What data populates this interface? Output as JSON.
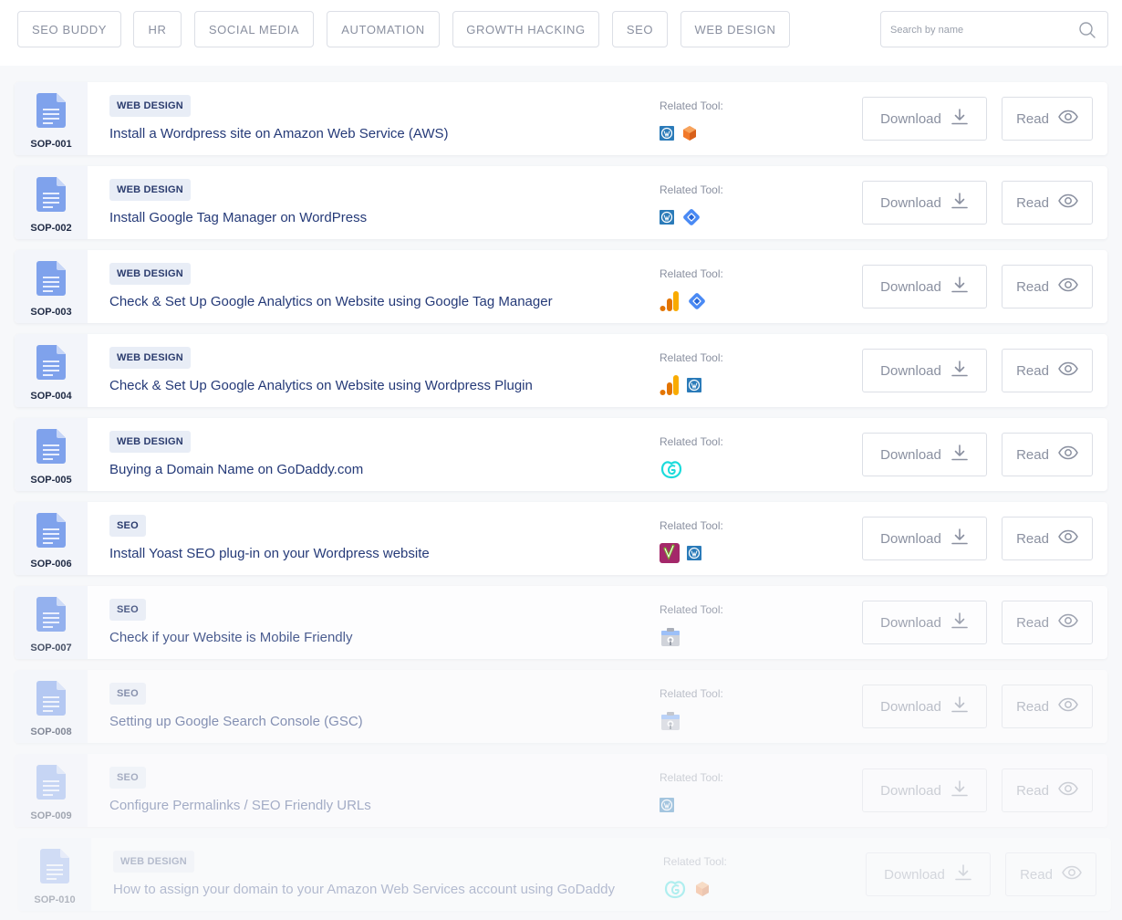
{
  "filters": [
    {
      "label": "SEO BUDDY"
    },
    {
      "label": "HR"
    },
    {
      "label": "SOCIAL MEDIA"
    },
    {
      "label": "AUTOMATION"
    },
    {
      "label": "GROWTH HACKING"
    },
    {
      "label": "SEO"
    },
    {
      "label": "WEB DESIGN"
    }
  ],
  "search": {
    "placeholder": "Search by name",
    "value": ""
  },
  "related_label": "Related Tool:",
  "download_label": "Download",
  "read_label": "Read",
  "sops": [
    {
      "code": "SOP-001",
      "category": "WEB DESIGN",
      "title": "Install a Wordpress site on Amazon Web Service (AWS)",
      "tools": [
        "wordpress-icon",
        "aws-icon"
      ]
    },
    {
      "code": "SOP-002",
      "category": "WEB DESIGN",
      "title": "Install Google Tag Manager on WordPress",
      "tools": [
        "wordpress-icon",
        "google-tag-manager-icon"
      ]
    },
    {
      "code": "SOP-003",
      "category": "WEB DESIGN",
      "title": "Check & Set Up Google Analytics on Website using Google Tag Manager",
      "tools": [
        "google-analytics-icon",
        "google-tag-manager-icon"
      ]
    },
    {
      "code": "SOP-004",
      "category": "WEB DESIGN",
      "title": "Check & Set Up Google Analytics on Website using Wordpress Plugin",
      "tools": [
        "google-analytics-icon",
        "wordpress-icon"
      ]
    },
    {
      "code": "SOP-005",
      "category": "WEB DESIGN",
      "title": "Buying a Domain Name on GoDaddy.com",
      "tools": [
        "godaddy-icon"
      ]
    },
    {
      "code": "SOP-006",
      "category": "SEO",
      "title": "Install Yoast SEO plug-in on your Wordpress website",
      "tools": [
        "yoast-icon",
        "wordpress-icon"
      ]
    },
    {
      "code": "SOP-007",
      "category": "SEO",
      "title": "Check if your Website is Mobile Friendly",
      "tools": [
        "search-console-icon"
      ]
    },
    {
      "code": "SOP-008",
      "category": "SEO",
      "title": "Setting up Google Search Console (GSC)",
      "tools": [
        "search-console-icon"
      ]
    },
    {
      "code": "SOP-009",
      "category": "SEO",
      "title": "Configure Permalinks / SEO Friendly URLs",
      "tools": [
        "wordpress-icon"
      ]
    },
    {
      "code": "SOP-010",
      "category": "WEB DESIGN",
      "title": "How to assign your domain to your Amazon Web Services account using GoDaddy",
      "tools": [
        "godaddy-icon",
        "aws-icon"
      ]
    }
  ],
  "colors": {
    "accent_text": "#253a78",
    "badge_bg": "#e8edf6",
    "doc_icon": "#6f96e8"
  }
}
